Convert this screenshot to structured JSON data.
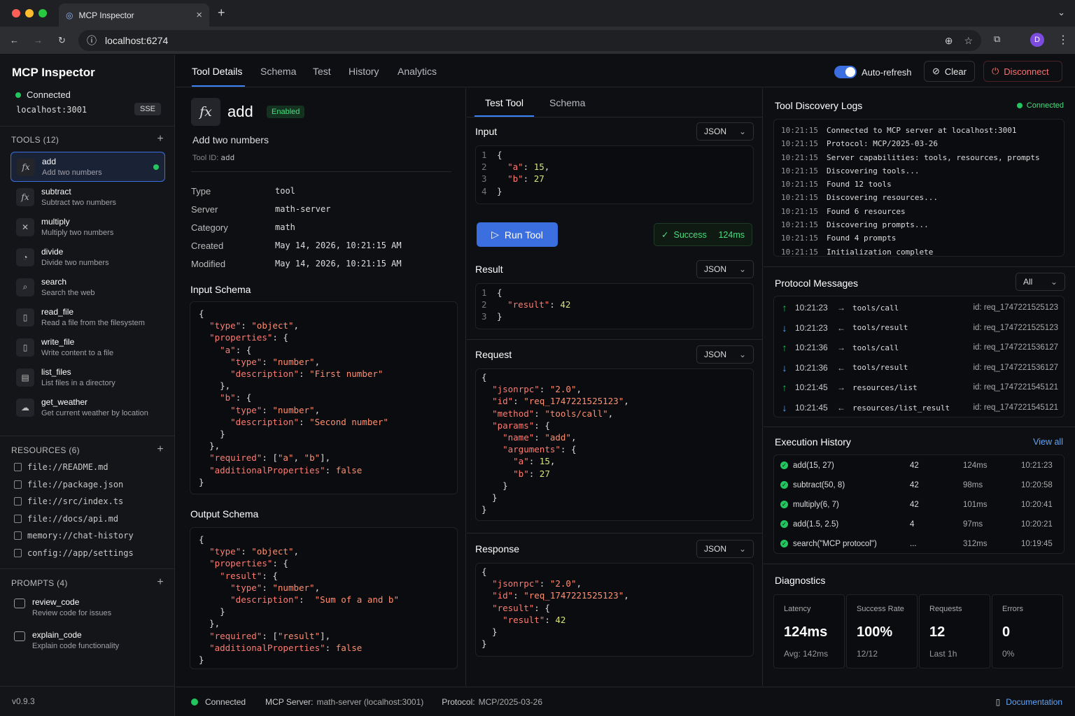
{
  "browser": {
    "tab_title": "MCP Inspector",
    "url": "localhost:6274",
    "avatar": "D"
  },
  "sidebar": {
    "title": "MCP Inspector",
    "status": "Connected",
    "host": "localhost:3001",
    "transport": "SSE",
    "tools_header": "TOOLS (12)",
    "tools": [
      {
        "name": "add",
        "desc": "Add two numbers",
        "icon": "fx-icon",
        "glyph": "fx"
      },
      {
        "name": "subtract",
        "desc": "Subtract two numbers",
        "icon": "fx-icon",
        "glyph": "fx"
      },
      {
        "name": "multiply",
        "desc": "Multiply two numbers",
        "icon": "x-icon",
        "glyph": "✕"
      },
      {
        "name": "divide",
        "desc": "Divide two numbers",
        "icon": "divide-icon",
        "glyph": "◔"
      },
      {
        "name": "search",
        "desc": "Search the web",
        "icon": "search-icon",
        "glyph": "⌕"
      },
      {
        "name": "read_file",
        "desc": "Read a file from the filesystem",
        "icon": "file-icon",
        "glyph": "▯"
      },
      {
        "name": "write_file",
        "desc": "Write content to a file",
        "icon": "file-icon",
        "glyph": "▯"
      },
      {
        "name": "list_files",
        "desc": "List files in a directory",
        "icon": "file-list-icon",
        "glyph": "▤"
      },
      {
        "name": "get_weather",
        "desc": "Get current weather by location",
        "icon": "weather-icon",
        "glyph": "☁"
      }
    ],
    "resources_header": "RESOURCES (6)",
    "resources": [
      "file://README.md",
      "file://package.json",
      "file://src/index.ts",
      "file://docs/api.md",
      "memory://chat-history",
      "config://app/settings"
    ],
    "prompts_header": "PROMPTS (4)",
    "prompts": [
      {
        "name": "review_code",
        "desc": "Review code for issues"
      },
      {
        "name": "explain_code",
        "desc": "Explain code functionality"
      }
    ],
    "version": "v0.9.3"
  },
  "topnav": {
    "tabs": [
      "Tool Details",
      "Schema",
      "Test",
      "History",
      "Analytics"
    ],
    "auto_refresh": "Auto-refresh",
    "clear": "Clear",
    "disconnect": "Disconnect"
  },
  "details": {
    "name": "add",
    "status": "Enabled",
    "description": "Add two numbers",
    "tool_id_label": "Tool ID:",
    "tool_id": "add",
    "props": [
      {
        "k": "Type",
        "v": "tool"
      },
      {
        "k": "Server",
        "v": "math-server"
      },
      {
        "k": "Category",
        "v": "math"
      },
      {
        "k": "Created",
        "v": "May 14, 2026, 10:21:15 AM"
      },
      {
        "k": "Modified",
        "v": "May 14, 2026, 10:21:15 AM"
      }
    ],
    "input_schema_title": "Input Schema",
    "output_schema_title": "Output Schema"
  },
  "test": {
    "tabs": [
      "Test Tool",
      "Schema"
    ],
    "input_title": "Input",
    "result_title": "Result",
    "request_title": "Request",
    "response_title": "Response",
    "format": "JSON",
    "run": "Run Tool",
    "success": "Success",
    "duration": "124ms"
  },
  "logs": {
    "title": "Tool Discovery Logs",
    "status": "Connected",
    "entries": [
      {
        "t": "10:21:15",
        "m": "Connected to MCP server at localhost:3001"
      },
      {
        "t": "10:21:15",
        "m": "Protocol: MCP/2025-03-26"
      },
      {
        "t": "10:21:15",
        "m": "Server capabilities: tools, resources, prompts"
      },
      {
        "t": "10:21:15",
        "m": "Discovering tools..."
      },
      {
        "t": "10:21:15",
        "m": "Found 12 tools"
      },
      {
        "t": "10:21:15",
        "m": "Discovering resources..."
      },
      {
        "t": "10:21:15",
        "m": "Found 6 resources"
      },
      {
        "t": "10:21:15",
        "m": "Discovering prompts..."
      },
      {
        "t": "10:21:15",
        "m": "Found 4 prompts"
      },
      {
        "t": "10:21:15",
        "m": "Initialization complete"
      }
    ]
  },
  "protocol": {
    "title": "Protocol Messages",
    "filter": "All",
    "messages": [
      {
        "dir": "out",
        "time": "10:21:23",
        "method": "tools/call",
        "id": "id: req_1747221525123"
      },
      {
        "dir": "in",
        "time": "10:21:23",
        "method": "tools/result",
        "id": "id: req_1747221525123"
      },
      {
        "dir": "out",
        "time": "10:21:36",
        "method": "tools/call",
        "id": "id: req_1747221536127"
      },
      {
        "dir": "in",
        "time": "10:21:36",
        "method": "tools/result",
        "id": "id: req_1747221536127"
      },
      {
        "dir": "out",
        "time": "10:21:45",
        "method": "resources/list",
        "id": "id: req_1747221545121"
      },
      {
        "dir": "in",
        "time": "10:21:45",
        "method": "resources/list_result",
        "id": "id: req_1747221545121"
      }
    ]
  },
  "history": {
    "title": "Execution History",
    "view_all": "View all",
    "rows": [
      {
        "call": "add(15, 27)",
        "result": "42",
        "ms": "124ms",
        "time": "10:21:23"
      },
      {
        "call": "subtract(50, 8)",
        "result": "42",
        "ms": "98ms",
        "time": "10:20:58"
      },
      {
        "call": "multiply(6, 7)",
        "result": "42",
        "ms": "101ms",
        "time": "10:20:41"
      },
      {
        "call": "add(1.5, 2.5)",
        "result": "4",
        "ms": "97ms",
        "time": "10:20:21"
      },
      {
        "call": "search(\"MCP protocol\")",
        "result": "...",
        "ms": "312ms",
        "time": "10:19:45"
      }
    ]
  },
  "diagnostics": {
    "title": "Diagnostics",
    "cells": [
      {
        "label": "Latency",
        "value": "124ms",
        "sub": "Avg: 142ms"
      },
      {
        "label": "Success Rate",
        "value": "100%",
        "sub": "12/12"
      },
      {
        "label": "Requests",
        "value": "12",
        "sub": "Last 1h"
      },
      {
        "label": "Errors",
        "value": "0",
        "sub": "0%"
      }
    ]
  },
  "statusbar": {
    "status": "Connected",
    "server_label": "MCP Server:",
    "server": "math-server (localhost:3001)",
    "protocol_label": "Protocol:",
    "protocol": "MCP/2025-03-26",
    "docs": "Documentation"
  },
  "colors": {
    "accent": "#3b6fe0",
    "success": "#22c55e",
    "danger": "#ef4444"
  }
}
